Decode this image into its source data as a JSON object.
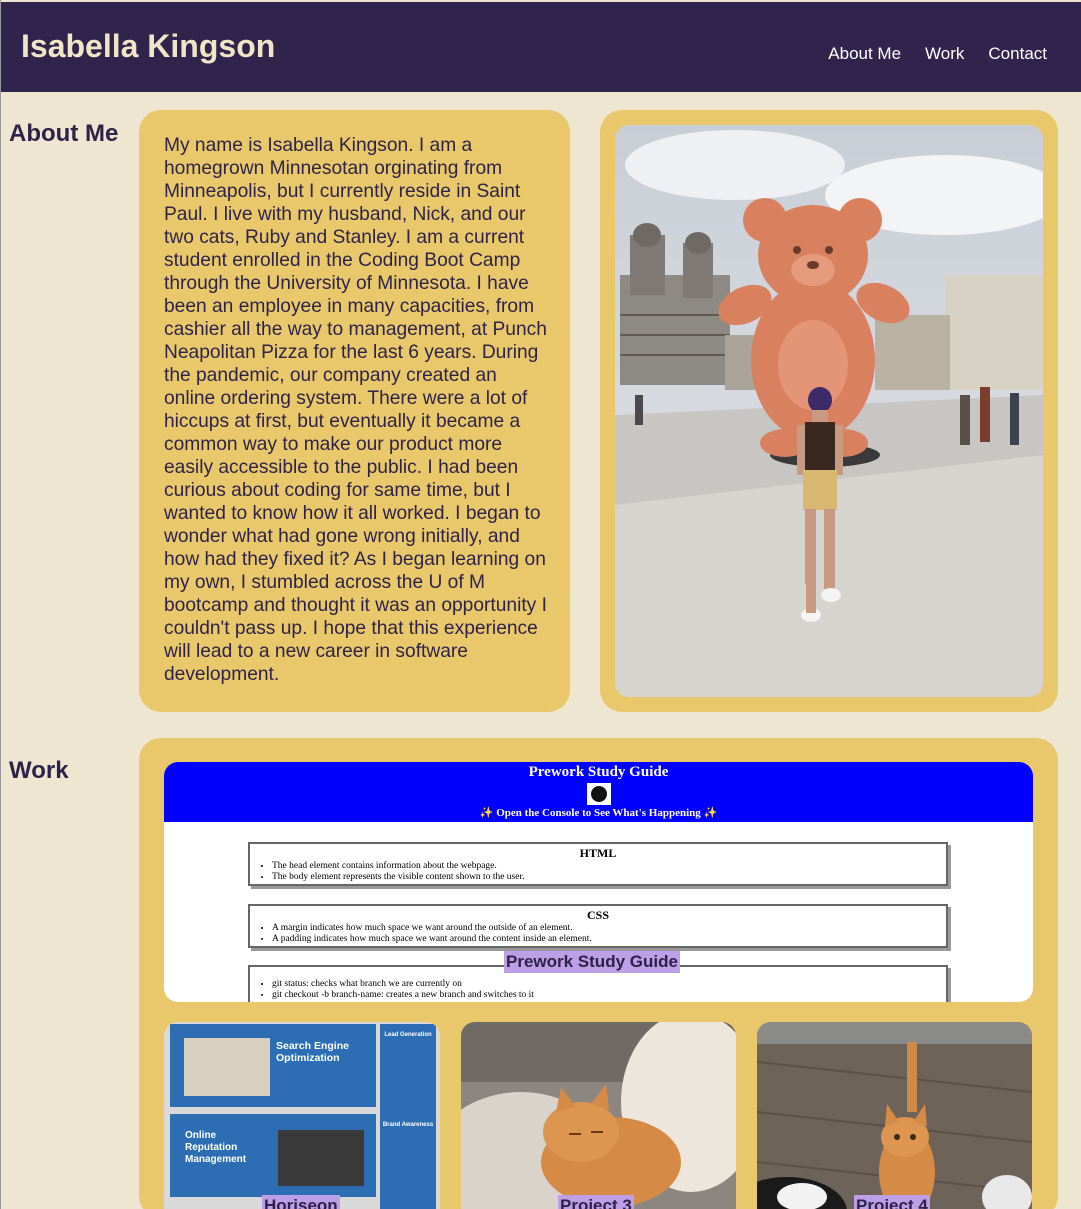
{
  "header": {
    "site_title": "Isabella Kingson",
    "nav": [
      "About Me",
      "Work",
      "Contact"
    ]
  },
  "about": {
    "heading": "About Me",
    "bio": "My name is Isabella Kingson. I am a homegrown Minnesotan orginating from Minneapolis, but I currently reside in Saint Paul. I live with my husband, Nick, and our two cats, Ruby and Stanley. I am a current student enrolled in the Coding Boot Camp through the University of Minnesota. I have been an employee in many capacities, from cashier all the way to management, at Punch Neapolitan Pizza for the last 6 years. During the pandemic, our company created an online ordering system. There were a lot of hiccups at first, but eventually it became a common way to make our product more easily accessible to the public. I had been curious about coding for same time, but I wanted to know how it all worked. I began to wonder what had gone wrong initially, and how had they fixed it? As I began learning on my own, I stumbled across the U of M bootcamp and thought it was an opportunity I couldn't pass up. I hope that this experience will lead to a new career in software development."
  },
  "work": {
    "heading": "Work",
    "featured": {
      "label": "Prework Study Guide",
      "screenshot": {
        "title": "Prework Study Guide",
        "subtitle": "✨ Open the Console to See What's Happening ✨",
        "boxes": [
          {
            "title": "HTML",
            "items": [
              "The head element contains information about the webpage.",
              "The body element represents the visible content shown to the user."
            ]
          },
          {
            "title": "CSS",
            "items": [
              "A margin indicates how much space we want around the outside of an element.",
              "A padding indicates how much space we want around the content inside an element."
            ]
          },
          {
            "title": "",
            "items": [
              "git status: checks what branch we are currently on",
              "git checkout -b branch-name: creates a new branch and switches to it"
            ]
          }
        ]
      }
    },
    "projects": [
      {
        "label": "Horiseon",
        "screenshot": {
          "seo_title": "Search Engine Optimization",
          "orm_title": "Online Reputation Management",
          "side1": "Lead Generation",
          "side2": "Brand Awareness"
        }
      },
      {
        "label": "Project 3"
      },
      {
        "label": "Project 4"
      }
    ]
  },
  "colors": {
    "header_bg": "#31244c",
    "page_bg": "#efe6d2",
    "card_bg": "#e8c86a",
    "label_bg": "#bc9fe6"
  }
}
